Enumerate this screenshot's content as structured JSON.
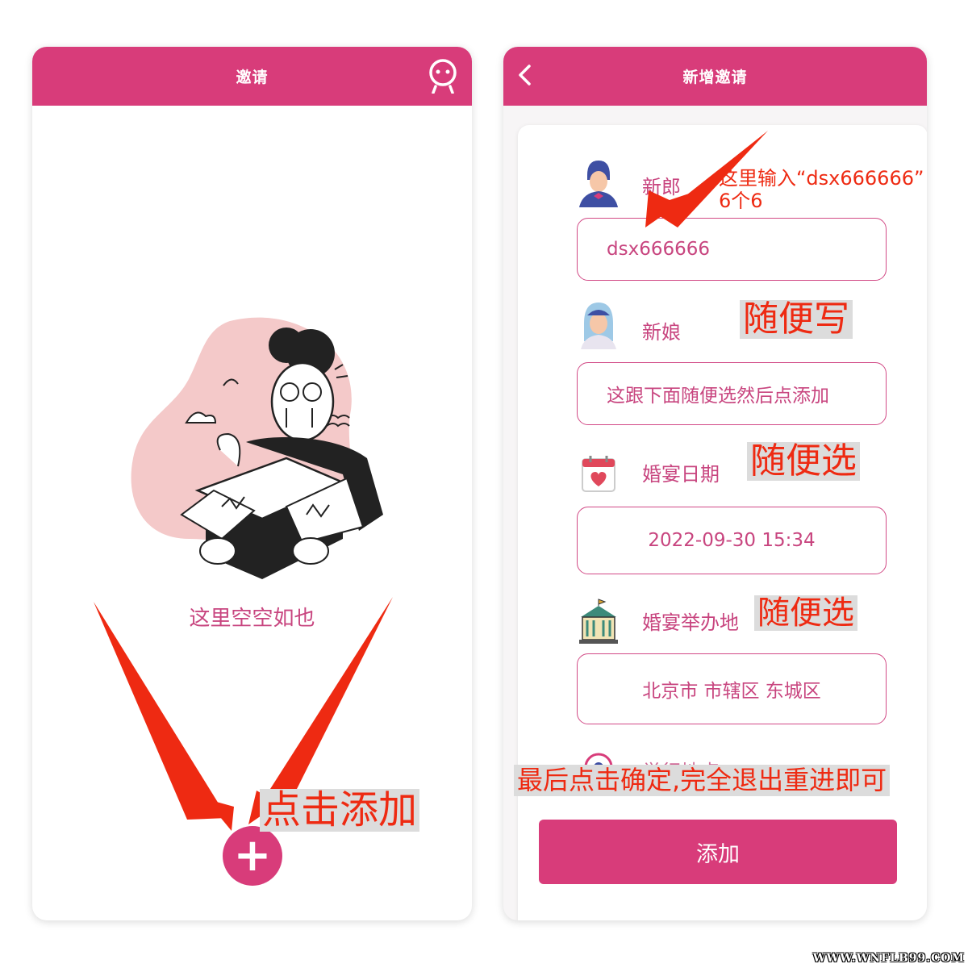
{
  "left_screen": {
    "header_title": "邀请",
    "empty_text": "这里空空如也",
    "add_button_symbol": "+",
    "profile_icon": "robot-face-icon"
  },
  "right_screen": {
    "header_title": "新增邀请",
    "back_icon": "chevron-left-icon",
    "fields": {
      "groom_label": "新郎",
      "groom_value": "dsx666666",
      "bride_label": "新娘",
      "bride_value": "这跟下面随便选然后点添加",
      "date_label": "婚宴日期",
      "date_value": "2022-09-30 15:34",
      "venue_label": "婚宴举办地",
      "venue_value": "北京市 市辖区 东城区",
      "partial_label": "举行地点"
    },
    "submit_label": "添加"
  },
  "annotations": {
    "click_add": "点击添加",
    "groom_hint_line1": "这里输入“dsx666666”",
    "groom_hint_line2": "6个6",
    "bride_hint": "随便写",
    "date_hint": "随便选",
    "venue_hint": "随便选",
    "final_hint": "最后点击确定,完全退出重进即可",
    "arrow_color": "#ee2a12"
  },
  "colors": {
    "brand": "#d83c7a",
    "label": "#c8457f",
    "annotation": "#ee2a12"
  },
  "watermark": "WWW.WNFLB99.COM"
}
